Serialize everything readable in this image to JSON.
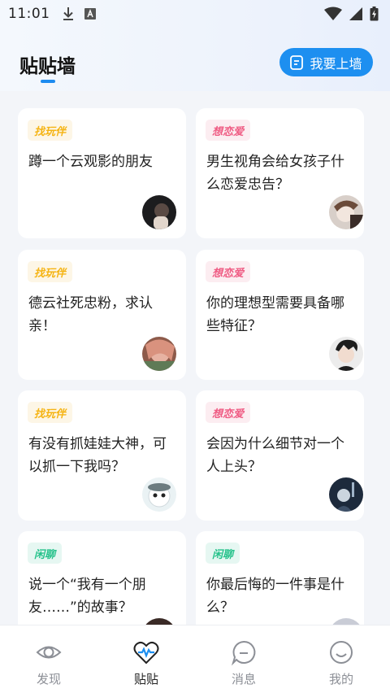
{
  "status_bar": {
    "time": "11:01"
  },
  "header": {
    "title": "贴贴墙",
    "post_button_label": "我要上墙"
  },
  "cards": [
    {
      "tag": "找玩伴",
      "text": "蹲一个云观影的朋友"
    },
    {
      "tag": "想恋爱",
      "text": "男生视角会给女孩子什么恋爱忠告？"
    },
    {
      "tag": "找玩伴",
      "text": "德云社死忠粉，求认亲！"
    },
    {
      "tag": "想恋爱",
      "text": "你的理想型需要具备哪些特征？"
    },
    {
      "tag": "找玩伴",
      "text": "有没有抓娃娃大神，可以抓一下我吗？"
    },
    {
      "tag": "想恋爱",
      "text": "会因为什么细节对一个人上头？"
    },
    {
      "tag": "闲聊",
      "text": "说一个“我有一个朋友……”的故事？"
    },
    {
      "tag": "闲聊",
      "text": "你最后悔的一件事是什么？"
    }
  ],
  "nav": [
    {
      "label": "发现",
      "icon": "eye-icon"
    },
    {
      "label": "贴贴",
      "icon": "heart-pulse-icon"
    },
    {
      "label": "消息",
      "icon": "message-icon"
    },
    {
      "label": "我的",
      "icon": "smile-icon"
    }
  ],
  "colors": {
    "accent": "#1d8ff0",
    "tag_yellow": "#f5b414",
    "tag_pink": "#ef5b83",
    "tag_green": "#26c28b"
  }
}
